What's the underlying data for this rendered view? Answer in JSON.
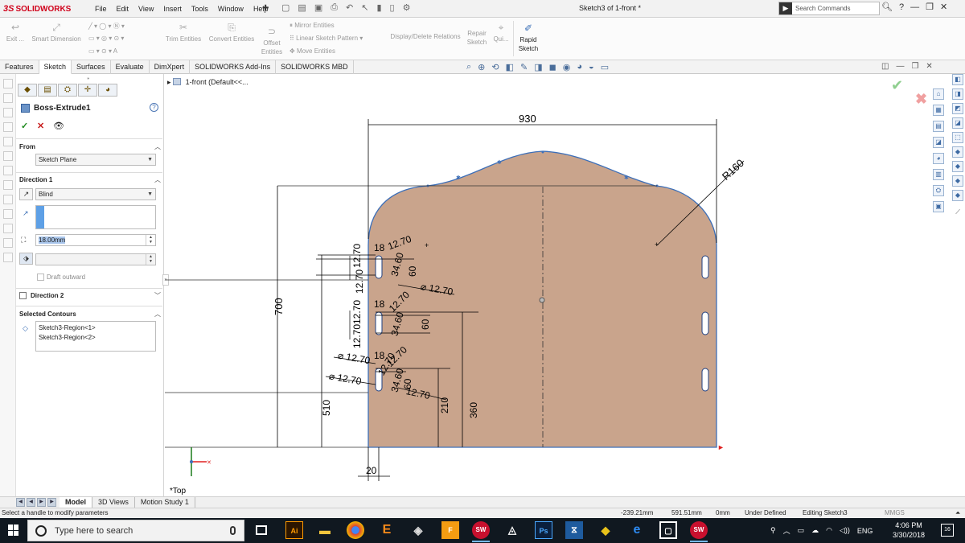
{
  "app": {
    "brand": "SOLIDWORKS",
    "brand_prefix": "3S",
    "document_title": "Sketch3 of 1-front *",
    "menu": [
      "File",
      "Edit",
      "View",
      "Insert",
      "Tools",
      "Window",
      "Help"
    ],
    "search_placeholder": "Search Commands"
  },
  "command_manager": {
    "exit_sketch": "Exit ...",
    "smart_dimension": "Smart Dimension",
    "trim_entities": "Trim Entities",
    "convert_entities": "Convert Entities",
    "offset_entities_1": "Offset",
    "offset_entities_2": "Entities",
    "mirror_entities": "Mirror Entities",
    "linear_pattern": "Linear Sketch Pattern",
    "move_entities": "Move Entities",
    "display_delete_relations": "Display/Delete Relations",
    "repair_sketch_1": "Repair",
    "repair_sketch_2": "Sketch",
    "quick_snaps": "Qui...",
    "rapid_sketch_1": "Rapid",
    "rapid_sketch_2": "Sketch"
  },
  "tabs": [
    "Features",
    "Sketch",
    "Surfaces",
    "Evaluate",
    "DimXpert",
    "SOLIDWORKS Add-Ins",
    "SOLIDWORKS MBD"
  ],
  "active_tab": "Sketch",
  "tree": {
    "root": "1-front  (Default<<..."
  },
  "property_manager": {
    "title": "Boss-Extrude1",
    "help": "?",
    "from": {
      "label": "From",
      "value": "Sketch Plane"
    },
    "direction1": {
      "label": "Direction 1",
      "end_condition": "Blind",
      "depth": "18.00mm",
      "draft_outward": "Draft outward"
    },
    "direction2": {
      "label": "Direction 2"
    },
    "selected_contours": {
      "label": "Selected Contours",
      "items": [
        "Sketch3-Region<1>",
        "Sketch3-Region<2>"
      ]
    }
  },
  "sketch": {
    "dims": {
      "width": "930",
      "radius": "R160",
      "height": "700",
      "h510": "510",
      "h360": "360",
      "h210": "210",
      "offset20": "20",
      "d60a": "60",
      "d60b": "60",
      "d60c": "60",
      "d1270": "12.70",
      "d1270_dia1": "⌀ 12.70",
      "d1270_dia2": "⌀ 12.70",
      "d1270_dia3": "⌀ 12.70",
      "d1270_b": "12.70",
      "d1270_c": "12.70",
      "d18a": "18",
      "d18b": "18",
      "d18c": "18",
      "d34a": "34.60",
      "d34b": "34.60",
      "d34c": "34.60",
      "v1270a": "12.70",
      "v1270b": "12.70",
      "v1270c": "12.70",
      "v1270d": "12.70",
      "v1270e": "12.70"
    },
    "view_label": "*Top",
    "colors": {
      "fill": "#c9a48c",
      "outline": "#3d6fb8",
      "dimension": "#000000",
      "axis_x": "#e02020",
      "axis_y": "#1a7a1a"
    }
  },
  "model_tabs": [
    "Model",
    "3D Views",
    "Motion Study 1"
  ],
  "active_model_tab": "Model",
  "status_bar": {
    "message": "Select a handle to modify parameters",
    "x": "-239.21mm",
    "y": "591.51mm",
    "z": "0mm",
    "state": "Under Defined",
    "mode": "Editing Sketch3",
    "units": "MMGS"
  },
  "taskbar": {
    "search_placeholder": "Type here to search",
    "apps": [
      "Ai",
      "E",
      "Ps"
    ],
    "language": "ENG",
    "time": "4:06 PM",
    "date": "3/30/2018",
    "notification_count": "16"
  }
}
